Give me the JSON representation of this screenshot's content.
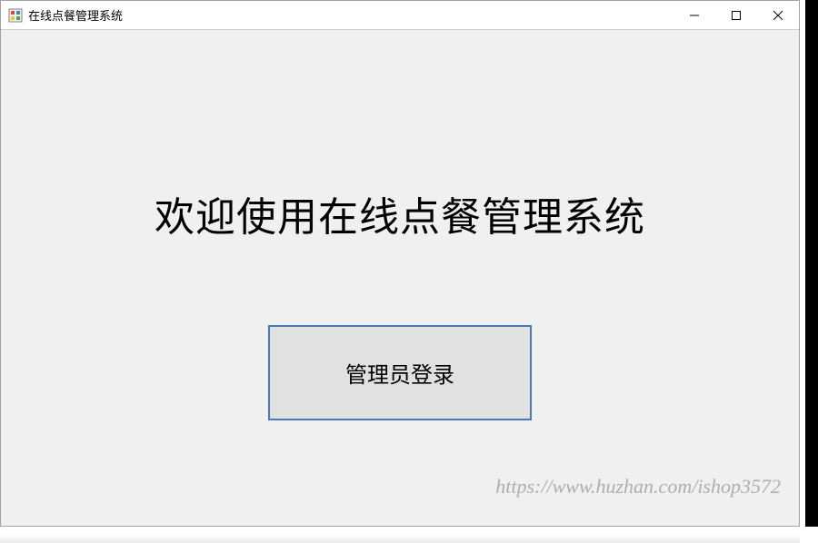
{
  "window": {
    "title": "在线点餐管理系统"
  },
  "main": {
    "heading": "欢迎使用在线点餐管理系统",
    "login_button_label": "管理员登录"
  },
  "watermark": {
    "text": "https://www.huzhan.com/ishop3572"
  }
}
